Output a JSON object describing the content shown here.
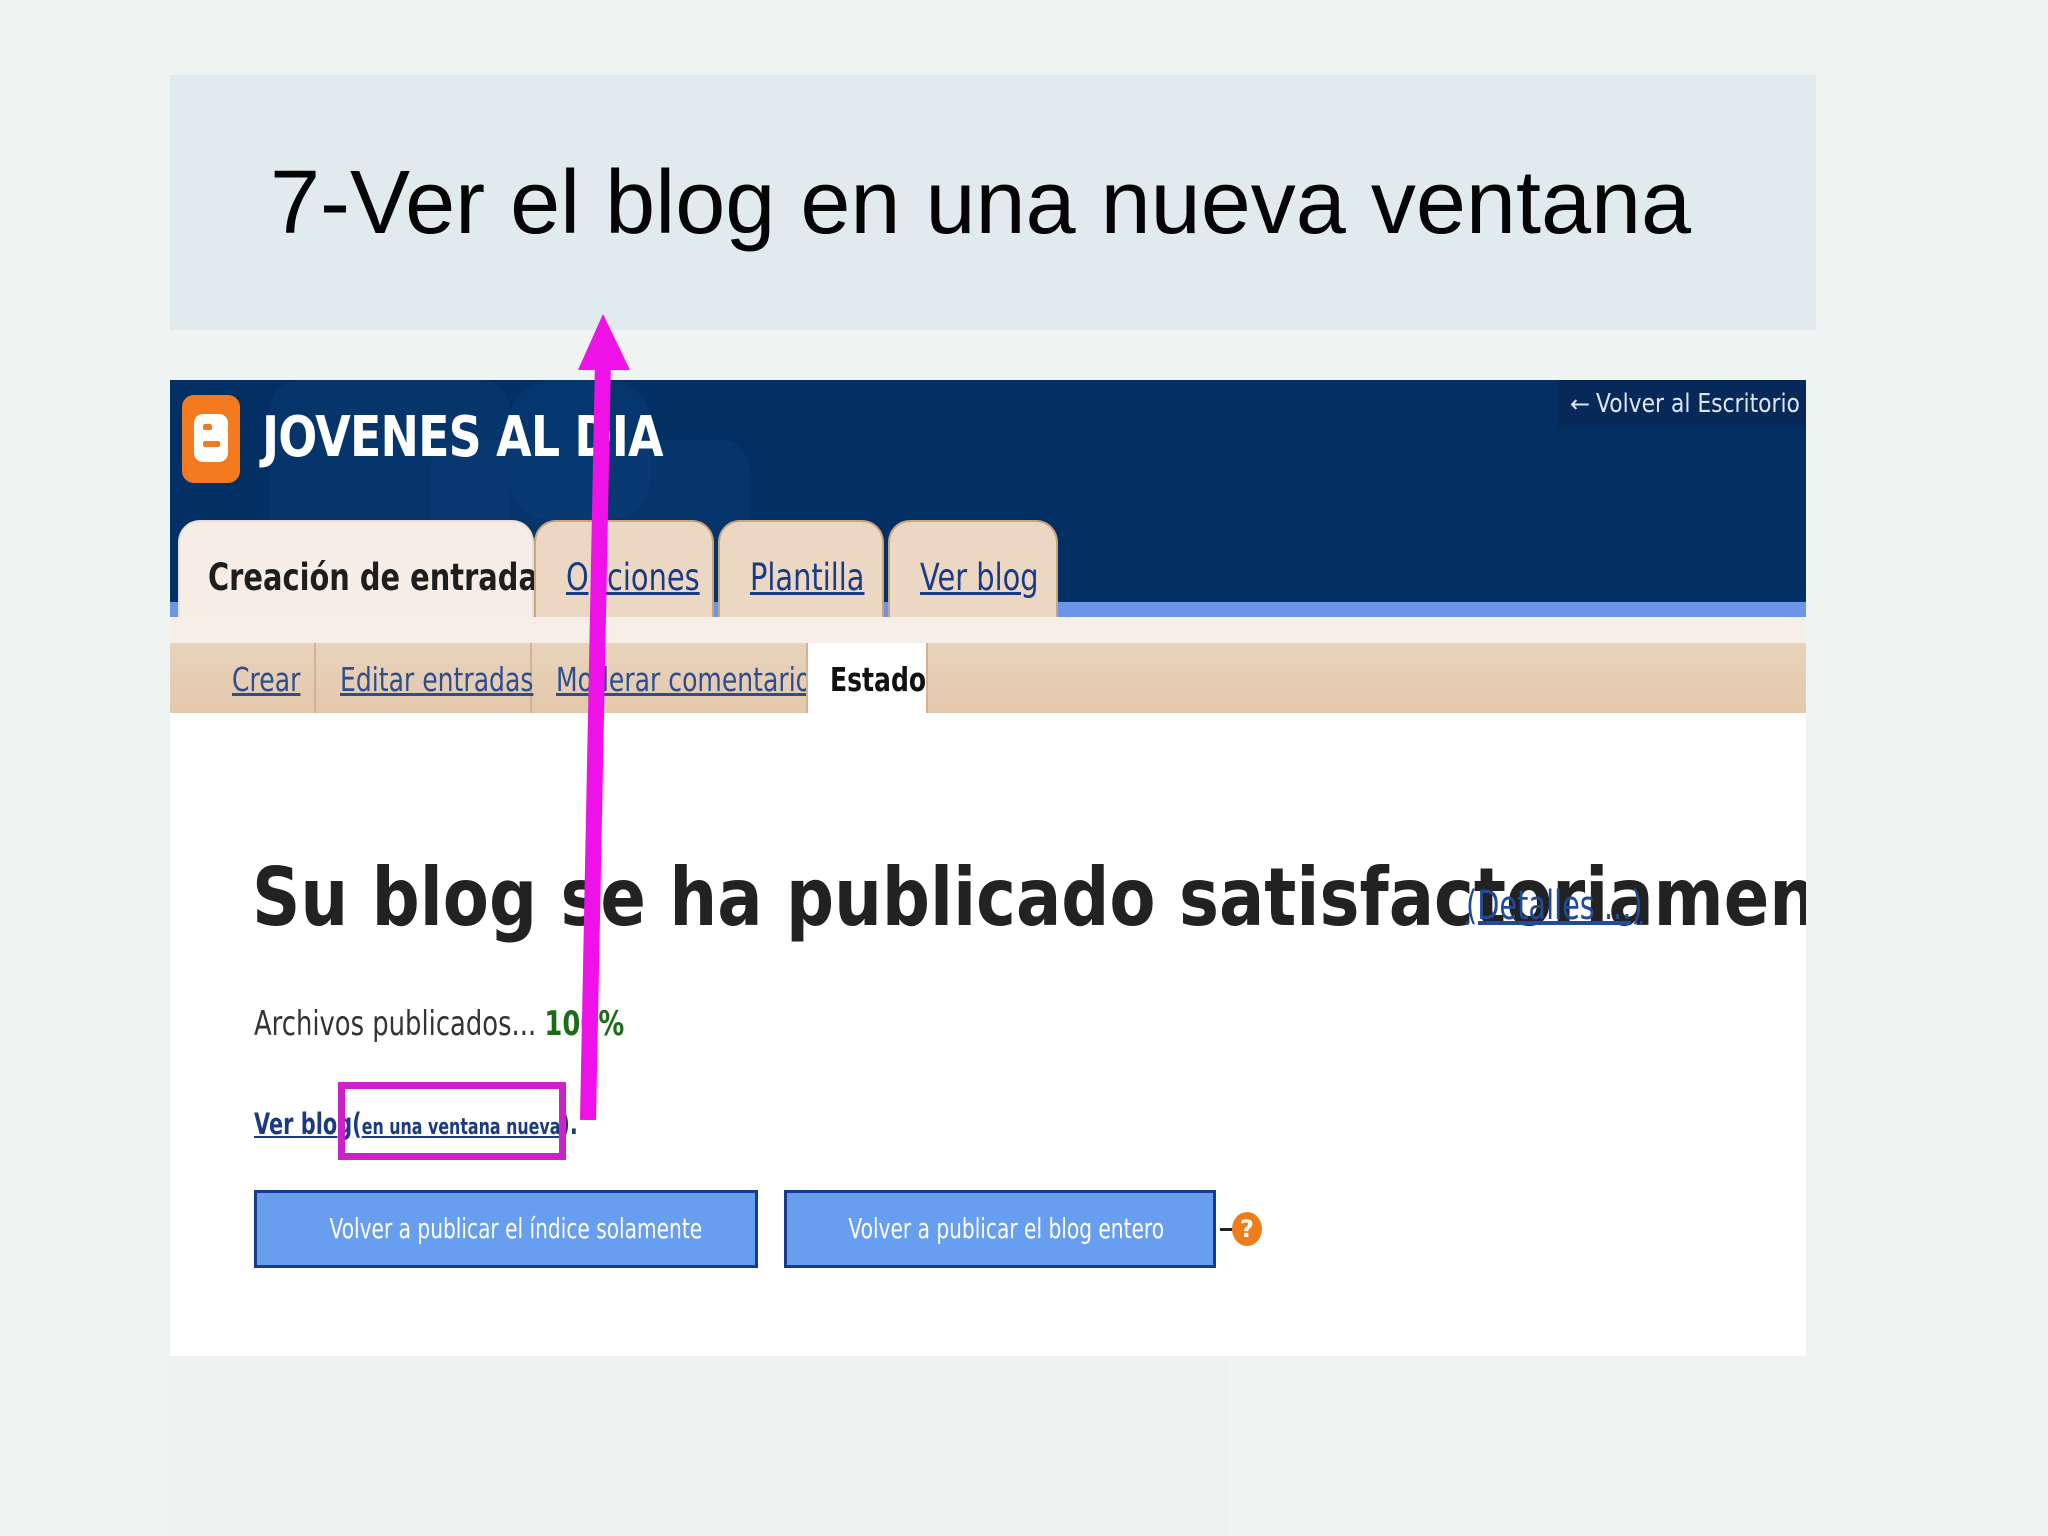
{
  "slide": {
    "title": "7-Ver el blog en una nueva ventana"
  },
  "header": {
    "blog_title": "JOVENES AL DIA",
    "back_link": "Volver al Escritorio",
    "back_arrow": "←"
  },
  "tabs": [
    {
      "label": "Creación de entradas",
      "active": true
    },
    {
      "label": "Opciones",
      "active": false
    },
    {
      "label": "Plantilla",
      "active": false
    },
    {
      "label": "Ver blog",
      "active": false
    }
  ],
  "subnav": [
    {
      "label": "Crear",
      "active": false
    },
    {
      "label": "Editar entradas",
      "active": false
    },
    {
      "label": "Moderar comentarios",
      "active": false
    },
    {
      "label": "Estado",
      "active": true
    }
  ],
  "status": {
    "message": "Su blog se ha publicado satisfactoriamente.",
    "details_link": "(Detalles ...)",
    "progress_label": "Archivos publicados...",
    "progress_value": "100%",
    "view_blog_link": "Ver blog",
    "view_paren_open": "(",
    "new_window_link": "en una ventana nueva",
    "view_paren_close": ")."
  },
  "buttons": {
    "republish_index": "Volver a publicar el índice solamente",
    "republish_all": "Volver a publicar el blog entero",
    "help": "?"
  },
  "colors": {
    "header_bg": "#033064",
    "button_bg": "#679ef0",
    "highlight": "#cc22c7",
    "annotation_arrow": "#ee11e8",
    "logo_orange": "#f47a20"
  },
  "icons": [
    "blogger-logo-icon",
    "back-arrow-icon",
    "help-icon",
    "annotation-arrow-icon"
  ]
}
